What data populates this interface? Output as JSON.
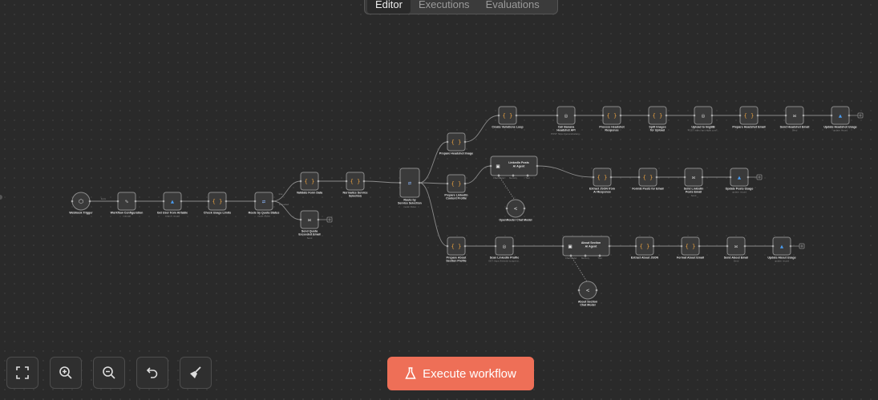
{
  "tabs": [
    {
      "label": "Editor",
      "active": true
    },
    {
      "label": "Executions",
      "active": false
    },
    {
      "label": "Evaluations",
      "active": false
    }
  ],
  "execute": {
    "label": "Execute workflow",
    "icon": "flask-icon",
    "color": "#ee6f57"
  },
  "toolbar": [
    {
      "name": "fit-view-button",
      "icon": "fit-view-icon"
    },
    {
      "name": "zoom-in-button",
      "icon": "zoom-in-icon"
    },
    {
      "name": "zoom-out-button",
      "icon": "zoom-out-icon"
    },
    {
      "name": "undo-button",
      "icon": "undo-icon"
    },
    {
      "name": "tidy-up-button",
      "icon": "broom-icon"
    }
  ],
  "edge_labels": {
    "webhook_out": "Form",
    "quota_true": "true",
    "quota_false": "exceeded"
  },
  "nodes": [
    {
      "id": "webhook",
      "label": "Webhook Trigger",
      "sub": "",
      "icon": "webhook-icon"
    },
    {
      "id": "config",
      "label": "Workflow Configuration",
      "sub": "manual",
      "icon": "pen-icon"
    },
    {
      "id": "get_user",
      "label": "Get User from Airtable",
      "sub": "search: record",
      "icon": "airtable-icon"
    },
    {
      "id": "check_usage",
      "label": "Check Usage Limits",
      "sub": "",
      "icon": "code-icon"
    },
    {
      "id": "quota",
      "label": "Route by Quota Status",
      "sub": "mode: Rules",
      "icon": "switch-icon"
    },
    {
      "id": "validate",
      "label": "Validate Form Data",
      "sub": "",
      "icon": "code-icon"
    },
    {
      "id": "quota_email",
      "label": "Send Quota Exceeded Email",
      "sub": "Send",
      "icon": "email-icon"
    },
    {
      "id": "normalize",
      "label": "Normalize Service Selection",
      "sub": "",
      "icon": "code-icon"
    },
    {
      "id": "route_service",
      "label": "Route by Service Selection",
      "sub": "mode: Rules",
      "icon": "switch-icon"
    },
    {
      "id": "prep_headshot",
      "label": "Prepare Headshot Image",
      "sub": "",
      "icon": "code-icon"
    },
    {
      "id": "prep_linkedin",
      "label": "Prepare LinkedIn Content Profile",
      "sub": "",
      "icon": "code-icon"
    },
    {
      "id": "prep_about",
      "label": "Prepare About Section Profile",
      "sub": "",
      "icon": "code-icon"
    },
    {
      "id": "create_variations",
      "label": "Create Variations Loop",
      "sub": "",
      "icon": "code-icon"
    },
    {
      "id": "call_banana",
      "label": "Call Banana Headshot API",
      "sub": "POST: https://generativelang...",
      "icon": "globe-icon"
    },
    {
      "id": "process_headshot",
      "label": "Process Headshot Response",
      "sub": "",
      "icon": "code-icon"
    },
    {
      "id": "split_images",
      "label": "Split Images for Upload",
      "sub": "",
      "icon": "code-icon"
    },
    {
      "id": "upload_imgbb",
      "label": "Upload to ImgBB",
      "sub": "POST: https://api.imgbb.com/...",
      "icon": "globe-icon"
    },
    {
      "id": "prep_headshot_email",
      "label": "Prepare Headshot Email",
      "sub": "",
      "icon": "code-icon"
    },
    {
      "id": "send_headshot_email",
      "label": "Send Headshot Email",
      "sub": "Send",
      "icon": "email-icon"
    },
    {
      "id": "update_headshot_usage",
      "label": "Update Headshot Usage",
      "sub": "update: record",
      "icon": "airtable-icon"
    },
    {
      "id": "linkedin_agent",
      "label": "LinkedIn Posts AI Agent",
      "sub": "",
      "icon": "robot-icon"
    },
    {
      "id": "openrouter_linkedin",
      "label": "OpenRouter Chat Model",
      "sub": "",
      "icon": "openrouter-icon"
    },
    {
      "id": "extract_json",
      "label": "Extract JSON from AI Response",
      "sub": "",
      "icon": "code-icon"
    },
    {
      "id": "format_posts",
      "label": "Format Posts for Email",
      "sub": "",
      "icon": "code-icon"
    },
    {
      "id": "send_linkedin_email",
      "label": "Send LinkedIn Posts Email",
      "sub": "Send",
      "icon": "email-icon"
    },
    {
      "id": "update_posts_usage",
      "label": "Update Posts Usage",
      "sub": "update: record",
      "icon": "airtable-icon"
    },
    {
      "id": "scan_linkedin",
      "label": "Scan LinkedIn Profile",
      "sub": "GET: https://linkedin-scrape-ai...",
      "icon": "globe-icon"
    },
    {
      "id": "about_agent",
      "label": "About Section AI Agent",
      "sub": "",
      "icon": "robot-icon"
    },
    {
      "id": "about_model",
      "label": "About Section Chat Model",
      "sub": "",
      "icon": "openrouter-icon"
    },
    {
      "id": "extract_about_json",
      "label": "Extract About JSON",
      "sub": "",
      "icon": "code-icon"
    },
    {
      "id": "format_about_email",
      "label": "Format About Email",
      "sub": "",
      "icon": "code-icon"
    },
    {
      "id": "send_about_email",
      "label": "Send About Email",
      "sub": "Send",
      "icon": "email-icon"
    },
    {
      "id": "update_about_usage",
      "label": "Update About Usage",
      "sub": "update: record",
      "icon": "airtable-icon"
    }
  ],
  "agent_ports": {
    "linkedin_agent": [
      "Chat Model",
      "Memory",
      "Tool"
    ],
    "about_agent": [
      "Chat Model",
      "Memory",
      "Tool"
    ]
  }
}
